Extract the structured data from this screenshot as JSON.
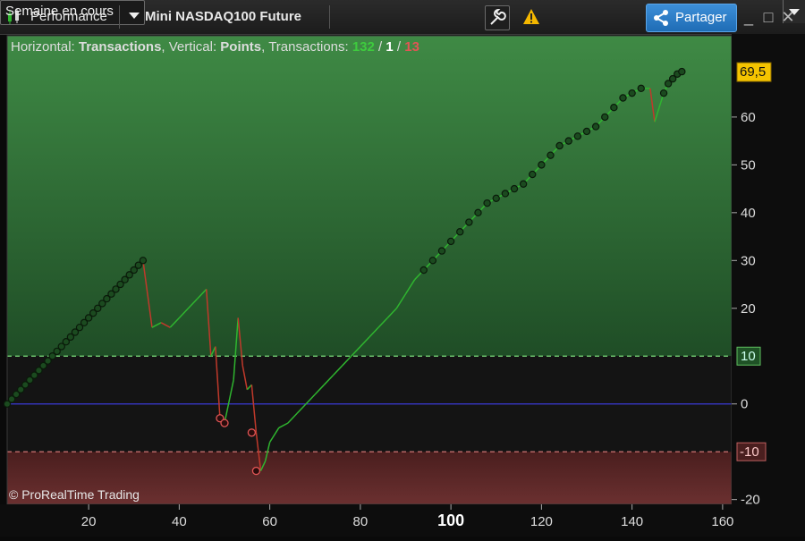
{
  "toolbar": {
    "title": "Performance",
    "instrument": "Mini NASDAQ100 Future",
    "period": "Semaine en cours",
    "share_label": "Partager",
    "window_buttons": [
      "_",
      "□",
      "✕"
    ]
  },
  "chart_header": {
    "label_horizontal": "Horizontal: ",
    "horizontal_value": "Transactions",
    "label_vertical": ", Vertical: ",
    "vertical_value": "Points",
    "label_transactions": ", Transactions: ",
    "count_total": "132",
    "slash1": " / ",
    "count_neutral": "1",
    "slash2": " / ",
    "count_loss": "13"
  },
  "watermark": "© ProRealTime Trading",
  "last_value_label": "69,5",
  "colors": {
    "profit_zone": "#2d6b36",
    "loss_zone": "#5a2626",
    "neutral_zone": "#1a1a1a",
    "gain_line": "#2fb52f",
    "loss_line": "#c0392b",
    "zero_line": "#3a3ad8",
    "upper_threshold": "#7ee07e",
    "lower_threshold": "#e07e7e",
    "last_value_badge": "#f5c400"
  },
  "chart_data": {
    "type": "line",
    "x_ticks": [
      20,
      40,
      60,
      80,
      100,
      120,
      140,
      160
    ],
    "x_highlight_tick": 100,
    "y_ticks": [
      60,
      50,
      40,
      30,
      20,
      0,
      -20
    ],
    "xlim": [
      2,
      162
    ],
    "ylim": [
      -21,
      77
    ],
    "upper_threshold": {
      "value": 10,
      "label": "10"
    },
    "lower_threshold": {
      "value": -10,
      "label": "-10"
    },
    "zero_line": 0,
    "last_value": 69.5,
    "equity_curve": [
      [
        2,
        0
      ],
      [
        3,
        1
      ],
      [
        4,
        2
      ],
      [
        5,
        3
      ],
      [
        6,
        4
      ],
      [
        7,
        5
      ],
      [
        8,
        6
      ],
      [
        9,
        7
      ],
      [
        10,
        8
      ],
      [
        11,
        9
      ],
      [
        12,
        10
      ],
      [
        13,
        11
      ],
      [
        14,
        12
      ],
      [
        15,
        13
      ],
      [
        16,
        14
      ],
      [
        17,
        15
      ],
      [
        18,
        16
      ],
      [
        19,
        17
      ],
      [
        20,
        18
      ],
      [
        21,
        19
      ],
      [
        22,
        20
      ],
      [
        23,
        21
      ],
      [
        24,
        22
      ],
      [
        25,
        23
      ],
      [
        26,
        24
      ],
      [
        27,
        25
      ],
      [
        28,
        26
      ],
      [
        29,
        27
      ],
      [
        30,
        28
      ],
      [
        31,
        29
      ],
      [
        32,
        30
      ],
      [
        34,
        16
      ],
      [
        36,
        17
      ],
      [
        38,
        16
      ],
      [
        40,
        18
      ],
      [
        42,
        20
      ],
      [
        44,
        22
      ],
      [
        46,
        24
      ],
      [
        47,
        10
      ],
      [
        48,
        12
      ],
      [
        49,
        -3
      ],
      [
        50,
        -4
      ],
      [
        52,
        5
      ],
      [
        53,
        18
      ],
      [
        54,
        8
      ],
      [
        55,
        3
      ],
      [
        56,
        4
      ],
      [
        57,
        -6
      ],
      [
        58,
        -14
      ],
      [
        59,
        -12
      ],
      [
        60,
        -8
      ],
      [
        62,
        -5
      ],
      [
        64,
        -4
      ],
      [
        66,
        -2
      ],
      [
        68,
        0
      ],
      [
        70,
        2
      ],
      [
        72,
        4
      ],
      [
        74,
        6
      ],
      [
        76,
        8
      ],
      [
        78,
        10
      ],
      [
        80,
        12
      ],
      [
        82,
        14
      ],
      [
        84,
        16
      ],
      [
        86,
        18
      ],
      [
        88,
        20
      ],
      [
        90,
        23
      ],
      [
        92,
        26
      ],
      [
        94,
        28
      ],
      [
        96,
        30
      ],
      [
        98,
        32
      ],
      [
        100,
        34
      ],
      [
        102,
        36
      ],
      [
        104,
        38
      ],
      [
        106,
        40
      ],
      [
        108,
        42
      ],
      [
        110,
        43
      ],
      [
        112,
        44
      ],
      [
        114,
        45
      ],
      [
        116,
        46
      ],
      [
        118,
        48
      ],
      [
        120,
        50
      ],
      [
        122,
        52
      ],
      [
        124,
        54
      ],
      [
        126,
        55
      ],
      [
        128,
        56
      ],
      [
        130,
        57
      ],
      [
        132,
        58
      ],
      [
        134,
        60
      ],
      [
        136,
        62
      ],
      [
        138,
        64
      ],
      [
        140,
        65
      ],
      [
        142,
        66
      ],
      [
        144,
        66
      ],
      [
        145,
        59
      ],
      [
        146,
        62
      ],
      [
        147,
        65
      ],
      [
        148,
        67
      ],
      [
        149,
        68
      ],
      [
        150,
        69
      ],
      [
        151,
        69.5
      ]
    ],
    "loss_segments": [
      [
        29,
        30
      ],
      [
        46,
        47
      ],
      [
        52,
        54
      ],
      [
        55,
        57
      ],
      [
        144,
        145
      ]
    ],
    "loss_markers": [
      [
        49,
        -3
      ],
      [
        50,
        -4
      ],
      [
        56,
        -6
      ],
      [
        57,
        -14
      ]
    ]
  }
}
